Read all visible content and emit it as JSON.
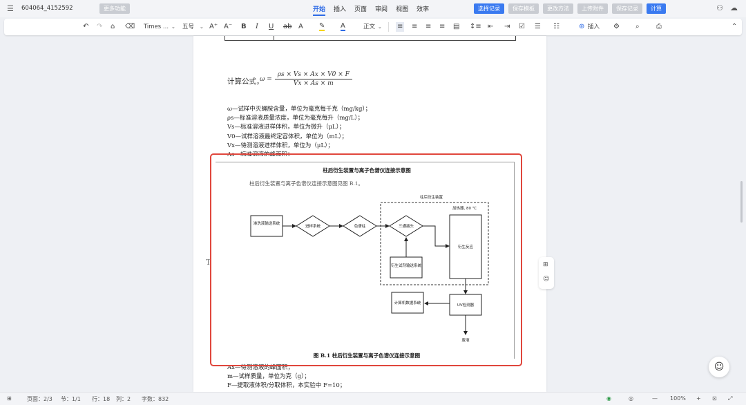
{
  "titlebar": {
    "doc_name": "604064_4152592",
    "more_label": "更多功能",
    "tabs": [
      "开始",
      "插入",
      "页面",
      "审阅",
      "视图",
      "效率"
    ],
    "actions": [
      "选择记录",
      "保存模板",
      "更改方法",
      "上传附件",
      "保存记录",
      "计算"
    ]
  },
  "toolbar": {
    "font_name": "Times ...",
    "font_size": "五号",
    "paragraph_style": "正文",
    "insert_label": "插入"
  },
  "document": {
    "formula_label": "计算公式，",
    "formula_prefix": "ω =",
    "formula_numerator": "ρs × Vs × Ax × V0 × F",
    "formula_denominator": "Vx × As × m",
    "definitions": [
      "ω—试样中灭蝇胺含量，单位为毫克每千克（mg/kg）；",
      "ρs—标准溶液质量浓度，单位为毫克每升（mg/L）；",
      "Vs—标准溶液进样体积，单位为微升（μL）；",
      "V0—试样溶液最终定容体积，单位为（mL）；",
      "Vx—待测溶液进样体积，单位为（μL）；",
      "As—标准溶液的峰面积；"
    ],
    "bottom_lines": [
      "Ax—待测溶液的峰面积；",
      "m—试样质量，单位为克（g）；",
      "F—提取液体积/分取体积，本实验中 F=10；"
    ]
  },
  "figure": {
    "title": "柱后衍生装置与离子色谱仪连接示意图",
    "subtitle": "柱后衍生装置与离子色谱仪连接示意图见图 B.1。",
    "dashed_group_label": "柱后衍生装置",
    "heater_label": "加热器, 80 ℃",
    "nodes": {
      "pump": "淋洗液输送系统",
      "injector": "进样系统",
      "column": "色谱柱",
      "tee": "三通接头",
      "reagent": "衍生试剂输送系统",
      "reactor": "衍生反应",
      "detector": "UV检测器",
      "computer": "计算机数据系统",
      "waste": "废液"
    },
    "caption": "图 B.1    柱后衍生装置与离子色谱仪连接示意图"
  },
  "statusbar": {
    "page": "页面：2/3",
    "section": "节：1/1",
    "row": "行：18",
    "col": "列：2",
    "words": "字数：832",
    "zoom": "100%"
  },
  "colors": {
    "accent": "#2e6be6",
    "highlight_frame": "#e0463c"
  }
}
